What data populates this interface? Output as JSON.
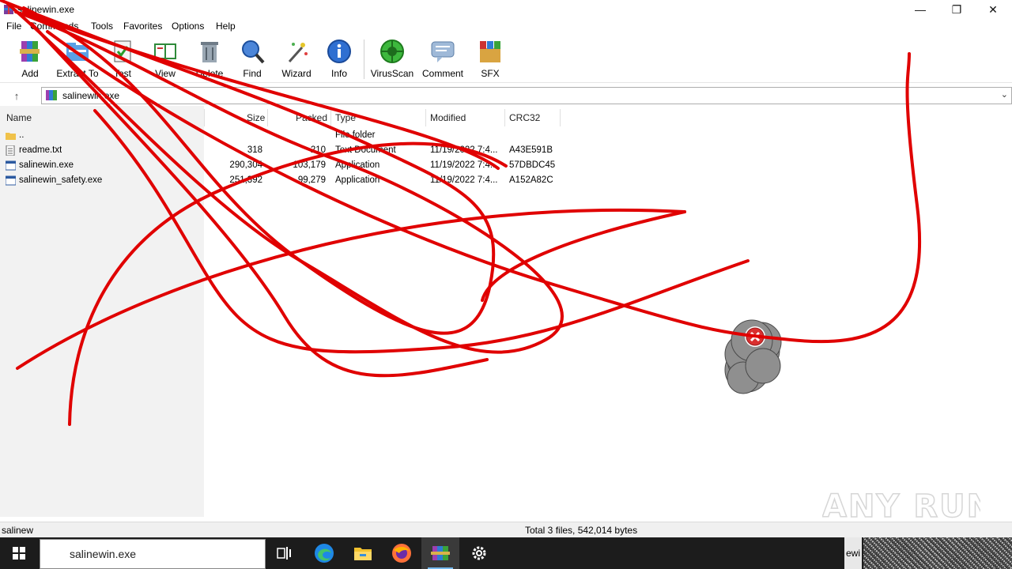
{
  "window": {
    "title": "salinewin.exe"
  },
  "menu": [
    "File",
    "Commands",
    "Tools",
    "Favorites",
    "Options",
    "Help"
  ],
  "toolbar": [
    {
      "label": "Add",
      "icon": "add-archive-icon"
    },
    {
      "label": "Extract To",
      "icon": "extract-to-icon"
    },
    {
      "label": "Test",
      "icon": "test-icon"
    },
    {
      "label": "View",
      "icon": "view-book-icon"
    },
    {
      "label": "Delete",
      "icon": "trash-can-icon"
    },
    {
      "label": "Find",
      "icon": "magnifier-icon"
    },
    {
      "label": "Wizard",
      "icon": "magic-wand-icon"
    },
    {
      "label": "Info",
      "icon": "info-icon"
    },
    {
      "label": "VirusScan",
      "icon": "virus-scan-icon"
    },
    {
      "label": "Comment",
      "icon": "comment-icon"
    },
    {
      "label": "SFX",
      "icon": "sfx-box-icon"
    }
  ],
  "address": {
    "path": "salinewin.exe"
  },
  "columns": {
    "name": "Name",
    "size": "Size",
    "packed": "Packed",
    "type": "Type",
    "modified": "Modified",
    "crc": "CRC32"
  },
  "files": [
    {
      "name": "..",
      "size": "",
      "packed": "",
      "type": "File folder",
      "modified": "",
      "crc": "",
      "icon": "folder-icon"
    },
    {
      "name": "readme.txt",
      "size": "318",
      "packed": "210",
      "type": "Text Document",
      "modified": "11/19/2022 7:4...",
      "crc": "A43E591B",
      "icon": "text-file-icon"
    },
    {
      "name": "salinewin.exe",
      "size": "290,304",
      "packed": "103,179",
      "type": "Application",
      "modified": "11/19/2022 7:4...",
      "crc": "57DBDC45",
      "icon": "exe-file-icon"
    },
    {
      "name": "salinewin_safety.exe",
      "size": "251,392",
      "packed": "99,279",
      "type": "Application",
      "modified": "11/19/2022 7:4...",
      "crc": "A152A82C",
      "icon": "exe-file-icon"
    }
  ],
  "status": {
    "left": "salinew",
    "right": "Total 3 files, 542,014 bytes"
  },
  "taskbar": {
    "search_text": "salinewin.exe",
    "tray_label": "ewi"
  },
  "watermark": "ANY RUN",
  "colors": {
    "accent": "#0078d7",
    "scribble": "#e00000",
    "taskbar": "#1c1c1c"
  }
}
